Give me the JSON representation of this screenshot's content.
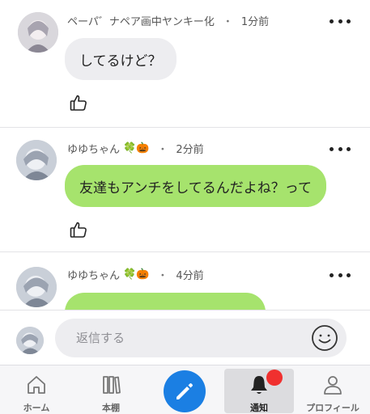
{
  "comments": [
    {
      "username": "ペーパ゛ナペア画中ヤンキー化",
      "separator": "・",
      "time": "1分前",
      "text": "してるけど？",
      "bubble_color": "#ededf0"
    },
    {
      "username": "ゆゆちゃん",
      "emoji": "🍀🎃",
      "separator": "・",
      "time": "2分前",
      "text": "友達もアンチをしてるんだよね？って",
      "bubble_color": "#a6e36d"
    },
    {
      "username": "ゆゆちゃん",
      "emoji": "🍀🎃",
      "separator": "・",
      "time": "4分前",
      "text": "",
      "bubble_color": "#a6e36d"
    }
  ],
  "reply": {
    "placeholder": "返信する"
  },
  "tabbar": {
    "tabs": [
      {
        "label": "ホーム",
        "icon": "home-icon"
      },
      {
        "label": "本棚",
        "icon": "bookshelf-icon"
      },
      {
        "label": "",
        "icon": "pencil-icon"
      },
      {
        "label": "通知",
        "icon": "bell-icon",
        "active": true
      },
      {
        "label": "プロフィール",
        "icon": "person-icon"
      }
    ],
    "accent_color": "#1b7fe3",
    "badge_color": "#f0302f"
  }
}
